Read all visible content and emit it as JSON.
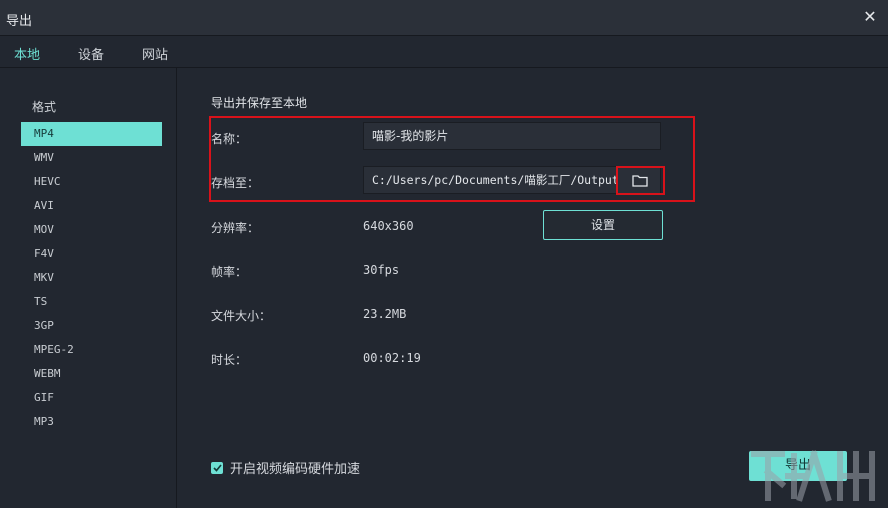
{
  "window": {
    "title": "导出"
  },
  "tabs": [
    {
      "label": "本地",
      "active": true
    },
    {
      "label": "设备",
      "active": false
    },
    {
      "label": "网站",
      "active": false
    }
  ],
  "sidebar": {
    "title": "格式",
    "formats": [
      "MP4",
      "WMV",
      "HEVC",
      "AVI",
      "MOV",
      "F4V",
      "MKV",
      "TS",
      "3GP",
      "MPEG-2",
      "WEBM",
      "GIF",
      "MP3"
    ],
    "selected": "MP4"
  },
  "main": {
    "section_title": "导出并保存至本地",
    "name_label": "名称：",
    "name_value": "喵影-我的影片",
    "save_label": "存档至：",
    "save_path": "C:/Users/pc/Documents/喵影工厂/Output",
    "resolution_label": "分辨率：",
    "resolution_value": "640x360",
    "settings_button": "设置",
    "framerate_label": "帧率：",
    "framerate_value": "30fps",
    "filesize_label": "文件大小：",
    "filesize_value": "23.2MB",
    "duration_label": "时长：",
    "duration_value": "00:02:19",
    "hw_accel_label": "开启视频编码硬件加速",
    "hw_accel_checked": true,
    "export_button": "导出"
  },
  "colors": {
    "accent": "#6ee0d4",
    "highlight": "#d8121a",
    "bg": "#222730"
  },
  "icons": {
    "close": "close-icon",
    "folder": "folder-icon",
    "check": "check-icon"
  }
}
